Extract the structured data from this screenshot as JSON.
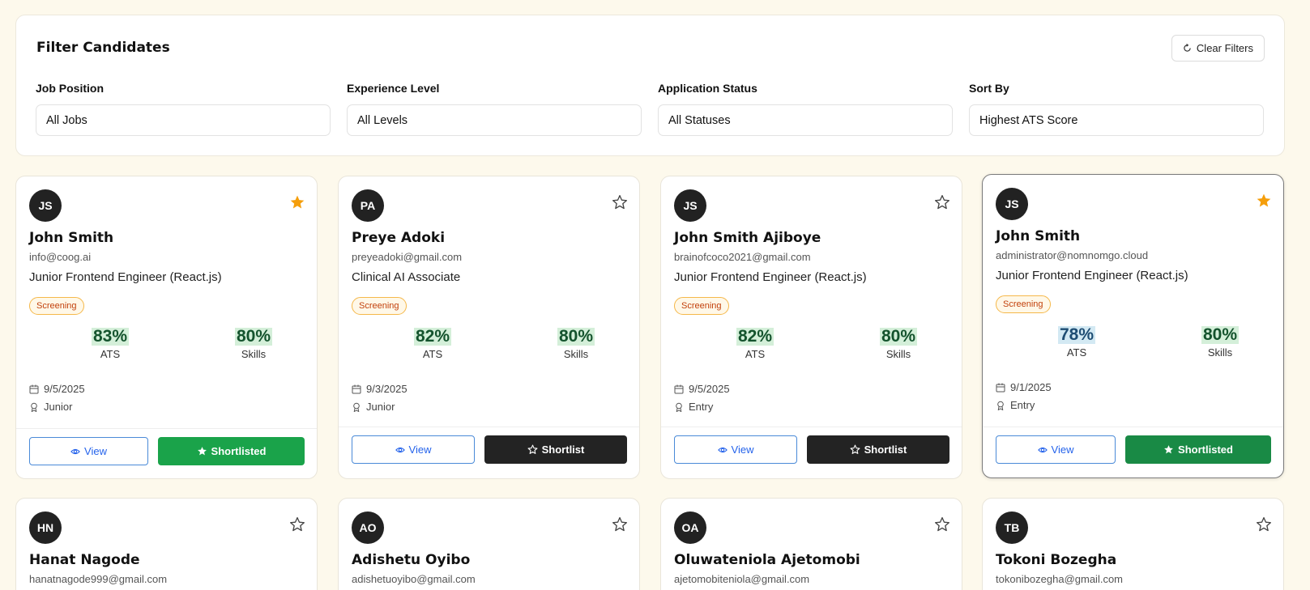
{
  "filters": {
    "title": "Filter Candidates",
    "clear_label": "Clear Filters",
    "groups": [
      {
        "label": "Job Position",
        "value": "All Jobs"
      },
      {
        "label": "Experience Level",
        "value": "All Levels"
      },
      {
        "label": "Application Status",
        "value": "All Statuses"
      },
      {
        "label": "Sort By",
        "value": "Highest ATS Score"
      }
    ]
  },
  "labels": {
    "ats": "ATS",
    "skills": "Skills",
    "view": "View",
    "shortlist": "Shortlist",
    "shortlisted": "Shortlisted"
  },
  "candidates": [
    {
      "initials": "JS",
      "name": "John Smith",
      "email": "info@coog.ai",
      "role": "Junior Frontend Engineer (React.js)",
      "status": "Screening",
      "ats": "83%",
      "skills": "80%",
      "date": "9/5/2025",
      "level": "Junior",
      "starred": true
    },
    {
      "initials": "PA",
      "name": "Preye Adoki",
      "email": "preyeadoki@gmail.com",
      "role": "Clinical AI Associate",
      "status": "Screening",
      "ats": "82%",
      "skills": "80%",
      "date": "9/3/2025",
      "level": "Junior",
      "starred": false
    },
    {
      "initials": "JS",
      "name": "John Smith Ajiboye",
      "email": "brainofcoco2021@gmail.com",
      "role": "Junior Frontend Engineer (React.js)",
      "status": "Screening",
      "ats": "82%",
      "skills": "80%",
      "date": "9/5/2025",
      "level": "Entry",
      "starred": false
    },
    {
      "initials": "JS",
      "name": "John Smith",
      "email": "administrator@nomnomgo.cloud",
      "role": "Junior Frontend Engineer (React.js)",
      "status": "Screening",
      "ats": "78%",
      "skills": "80%",
      "date": "9/1/2025",
      "level": "Entry",
      "starred": true
    },
    {
      "initials": "HN",
      "name": "Hanat Nagode",
      "email": "hanatnagode999@gmail.com",
      "starred": false
    },
    {
      "initials": "AO",
      "name": "Adishetu Oyibo",
      "email": "adishetuoyibo@gmail.com",
      "starred": false
    },
    {
      "initials": "OA",
      "name": "Oluwateniola Ajetomobi",
      "email": "ajetomobiteniola@gmail.com",
      "starred": false
    },
    {
      "initials": "TB",
      "name": "Tokoni Bozegha",
      "email": "tokonibozegha@gmail.com",
      "starred": false
    }
  ],
  "colors": {
    "page_bg": "#fdf9ec",
    "star_active": "#f59e0b",
    "shortlisted_green": "#1aa34a",
    "shortlist_dark": "#232323",
    "view_blue": "#2563eb",
    "badge_orange": "#c2410c"
  }
}
